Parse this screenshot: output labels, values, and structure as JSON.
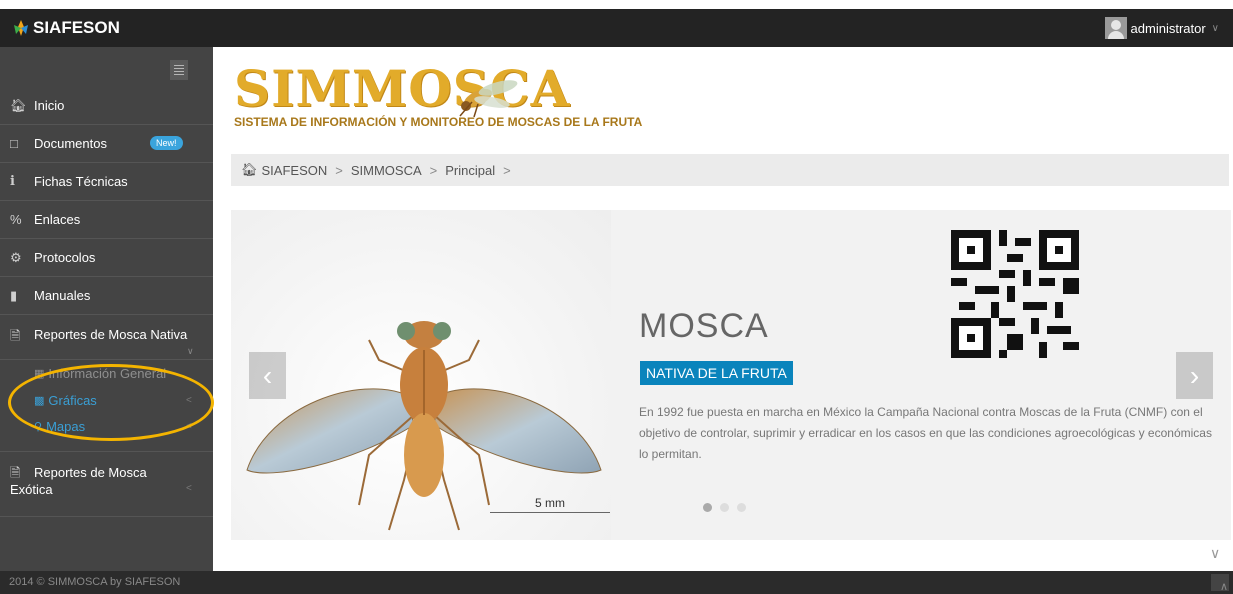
{
  "app": {
    "brand": "SIAFESON"
  },
  "header": {
    "user": "administrator"
  },
  "sidebar": {
    "items": [
      {
        "label": "Inicio",
        "icon": "home-icon"
      },
      {
        "label": "Documentos",
        "icon": "folder-icon",
        "badge": "New!"
      },
      {
        "label": "Fichas Técnicas",
        "icon": "info-icon"
      },
      {
        "label": "Enlaces",
        "icon": "link-icon"
      },
      {
        "label": "Protocolos",
        "icon": "gear-icon"
      },
      {
        "label": "Manuales",
        "icon": "book-icon"
      },
      {
        "label": "Reportes de Mosca Nativa",
        "icon": "file-icon"
      }
    ],
    "subitems": [
      {
        "label": "Información General",
        "icon": "table-icon"
      },
      {
        "label": "Gráficas",
        "icon": "chart-icon"
      },
      {
        "label": "Mapas",
        "icon": "map-marker-icon"
      }
    ],
    "exotic": {
      "label1": "Reportes de Mosca",
      "label2": "Exótica",
      "icon": "file-icon"
    }
  },
  "logo": {
    "word": "SIMMOSCA",
    "subtitle": "SISTEMA DE INFORMACIÓN Y MONITOREO DE MOSCAS DE LA FRUTA"
  },
  "breadcrumb": [
    "SIAFESON",
    "SIMMOSCA",
    "Principal"
  ],
  "slide": {
    "title": "MOSCA",
    "tag": "NATIVA DE LA FRUTA",
    "text": "En 1992 fue puesta en marcha en México la Campaña Nacional contra Moscas de la Fruta (CNMF) con el objetivo de controlar, suprimir y erradicar en los casos en que las condiciones agroecológicas y económicas lo permitan.",
    "scale_label": "5 mm",
    "dots": 3,
    "active_dot": 0
  },
  "footer": {
    "text": "2014 © SIMMOSCA by SIAFESON"
  },
  "colors": {
    "accent": "#0a84bc",
    "highlight": "#f4b400",
    "sidebar": "#444444",
    "topbar": "#232323"
  }
}
